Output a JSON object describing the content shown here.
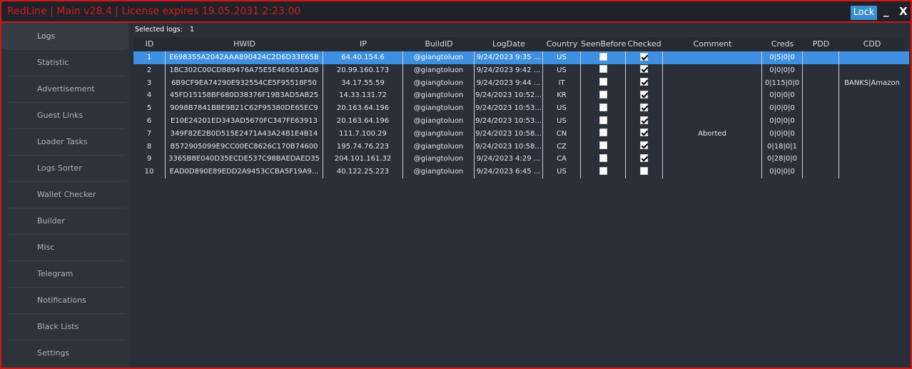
{
  "window": {
    "title": "RedLine | Main v28.4 | License expires 19.05.2031 2:23:00",
    "lock_label": "Lock",
    "minimize_label": "_",
    "close_label": "X"
  },
  "sidebar": {
    "items": [
      {
        "label": "Logs"
      },
      {
        "label": "Statistic"
      },
      {
        "label": "Advertisement"
      },
      {
        "label": "Guest Links"
      },
      {
        "label": "Loader Tasks"
      },
      {
        "label": "Logs Sorter"
      },
      {
        "label": "Wallet Checker"
      },
      {
        "label": "Builder"
      },
      {
        "label": "Misc"
      },
      {
        "label": "Telegram"
      },
      {
        "label": "Notifications"
      },
      {
        "label": "Black Lists"
      },
      {
        "label": "Settings"
      }
    ]
  },
  "main": {
    "selected_label": "Selected logs:",
    "selected_count": "1",
    "columns": [
      "ID",
      "HWID",
      "IP",
      "BuildID",
      "LogDate",
      "Country",
      "SeenBefore",
      "Checked",
      "Comment",
      "Creds",
      "PDD",
      "CDD"
    ],
    "rows": [
      {
        "id": "1",
        "hwid": "E698355A2042AAA890424C2D6D33E65B",
        "ip": "64.40.154.6",
        "build": "@giangtoluon",
        "date": "9/24/2023 9:35 ...",
        "country": "US",
        "seen": false,
        "checked": true,
        "comment": "",
        "creds": "0|5|0|0",
        "pdd": "",
        "cdd": ""
      },
      {
        "id": "2",
        "hwid": "1BC302C00CD889476A75E5E465651AD8",
        "ip": "20.99.160.173",
        "build": "@giangtoluon",
        "date": "9/24/2023 9:42 ...",
        "country": "US",
        "seen": false,
        "checked": true,
        "comment": "",
        "creds": "0|0|0|0",
        "pdd": "",
        "cdd": ""
      },
      {
        "id": "3",
        "hwid": "6B9CF9EA74290E932554CE5F95518F50",
        "ip": "34.17.55.59",
        "build": "@giangtoluon",
        "date": "9/24/2023 9:44 ...",
        "country": "IT",
        "seen": false,
        "checked": true,
        "comment": "",
        "creds": "0|115|0|0",
        "pdd": "",
        "cdd": "BANKS|Amazon"
      },
      {
        "id": "4",
        "hwid": "45FD15158BF680D38376F19B3AD5AB25",
        "ip": "14.33.131.72",
        "build": "@giangtoluon",
        "date": "9/24/2023 10:52...",
        "country": "KR",
        "seen": false,
        "checked": true,
        "comment": "",
        "creds": "0|0|0|0",
        "pdd": "",
        "cdd": ""
      },
      {
        "id": "5",
        "hwid": "9098B7841BBE9B21C62F95380DE65EC9",
        "ip": "20.163.64.196",
        "build": "@giangtoluon",
        "date": "9/24/2023 10:53...",
        "country": "US",
        "seen": false,
        "checked": true,
        "comment": "",
        "creds": "0|0|0|0",
        "pdd": "",
        "cdd": ""
      },
      {
        "id": "6",
        "hwid": "E10E24201ED343AD5670FC347FE63913",
        "ip": "20.163.64.196",
        "build": "@giangtoluon",
        "date": "9/24/2023 10:53...",
        "country": "US",
        "seen": false,
        "checked": true,
        "comment": "",
        "creds": "0|0|0|0",
        "pdd": "",
        "cdd": ""
      },
      {
        "id": "7",
        "hwid": "349F82E2B0D515E2471A43A24B1E4B14",
        "ip": "111.7.100.29",
        "build": "@giangtoluon",
        "date": "9/24/2023 10:58...",
        "country": "CN",
        "seen": false,
        "checked": true,
        "comment": "Aborted",
        "creds": "0|0|0|0",
        "pdd": "",
        "cdd": ""
      },
      {
        "id": "8",
        "hwid": "B572905099E9CC00EC8626C170B74600",
        "ip": "195.74.76.223",
        "build": "@giangtoluon",
        "date": "9/24/2023 10:58...",
        "country": "CZ",
        "seen": false,
        "checked": true,
        "comment": "",
        "creds": "0|18|0|1",
        "pdd": "",
        "cdd": ""
      },
      {
        "id": "9",
        "hwid": "3365B8E040D35ECDE537C98BAEDAED35",
        "ip": "204.101.161.32",
        "build": "@giangtoluon",
        "date": "9/24/2023 4:29 ...",
        "country": "CA",
        "seen": false,
        "checked": true,
        "comment": "",
        "creds": "0|28|0|0",
        "pdd": "",
        "cdd": ""
      },
      {
        "id": "10",
        "hwid": "EAD0D890E89EDD2A9453CCBA5F19A9...",
        "ip": "40.122.25.223",
        "build": "@giangtoluon",
        "date": "9/24/2023 6:45 ...",
        "country": "US",
        "seen": false,
        "checked": false,
        "comment": "",
        "creds": "0|0|0|0",
        "pdd": "",
        "cdd": ""
      }
    ]
  },
  "colors": {
    "accent_red": "#d01818",
    "selection_blue": "#3e8fe0",
    "lock_button": "#3b8fd0"
  }
}
